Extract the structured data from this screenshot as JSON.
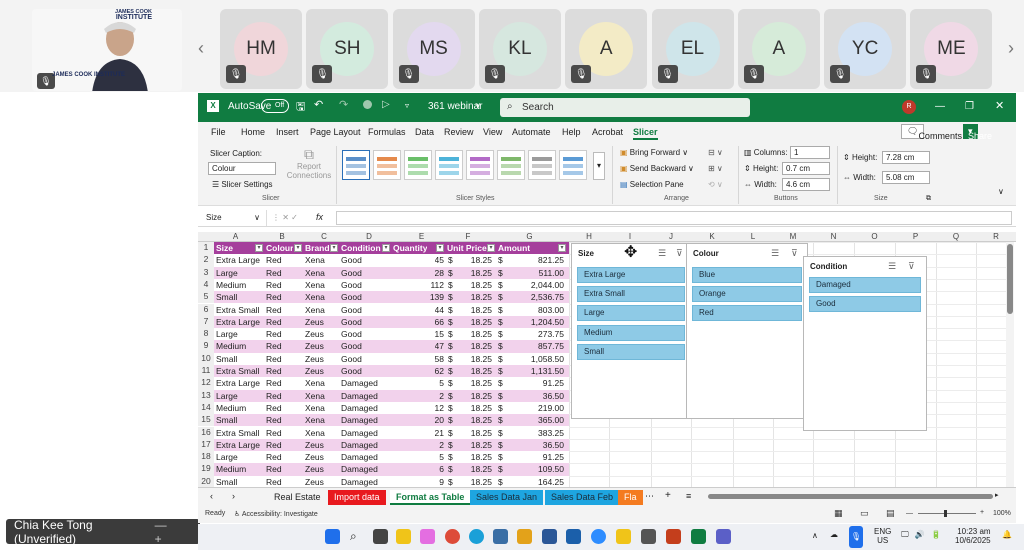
{
  "meeting": {
    "self_logo_line1": "JAMES COOK",
    "self_logo_line2": "INSTITUTE",
    "self_logo_overlay": "JAMES COOK INSTITUTE",
    "participants": [
      {
        "initials": "HM",
        "color": "#f0d6da"
      },
      {
        "initials": "SH",
        "color": "#d3ebde"
      },
      {
        "initials": "MS",
        "color": "#e3d9ef"
      },
      {
        "initials": "KL",
        "color": "#d6e7df"
      },
      {
        "initials": "A",
        "color": "#f3ebc6"
      },
      {
        "initials": "EL",
        "color": "#cfe5ea"
      },
      {
        "initials": "A",
        "color": "#d6ebd9"
      },
      {
        "initials": "YC",
        "color": "#d3e2f3"
      },
      {
        "initials": "ME",
        "color": "#f0d9e6"
      }
    ],
    "prev_arrow": "‹",
    "next_arrow": "›",
    "self_name": "Chia Kee Tong (Unverified)"
  },
  "excel": {
    "autosave_label": "AutoSave",
    "autosave_state": "Off",
    "file_name": "361 webinar",
    "search_placeholder": "Search",
    "user_initial": "R",
    "menu": [
      "File",
      "Home",
      "Insert",
      "Page Layout",
      "Formulas",
      "Data",
      "Review",
      "View",
      "Automate",
      "Help",
      "Acrobat",
      "Slicer"
    ],
    "comments_label": "Comments",
    "share_label": "Share",
    "ribbon": {
      "slicer_caption_label": "Slicer Caption:",
      "slicer_caption_value": "Colour",
      "slicer_settings": "Slicer Settings",
      "report_connections_1": "Report",
      "report_connections_2": "Connections",
      "group_slicer": "Slicer",
      "group_styles": "Slicer Styles",
      "bring_forward": "Bring Forward",
      "send_backward": "Send Backward",
      "selection_pane": "Selection Pane",
      "group_arrange": "Arrange",
      "columns_label": "Columns:",
      "columns_value": "1",
      "height_label": "Height:",
      "height_value": "0.7 cm",
      "width_label": "Width:",
      "width_value": "4.6 cm",
      "group_buttons": "Buttons",
      "size_height_label": "Height:",
      "size_height_value": "7.28 cm",
      "size_width_label": "Width:",
      "size_width_value": "5.08 cm",
      "group_size": "Size"
    },
    "name_box": "Size",
    "fx": "fx",
    "columns": [
      "A",
      "B",
      "C",
      "D",
      "E",
      "F",
      "G",
      "H",
      "I",
      "J",
      "K",
      "L",
      "M",
      "N",
      "O",
      "P",
      "Q",
      "R"
    ],
    "table_headers": [
      "Size",
      "Colour",
      "Brand",
      "Condition",
      "Quantity",
      "Unit Price",
      "Amount"
    ],
    "rows": [
      [
        "2",
        "Extra Large",
        "Red",
        "Xena",
        "Good",
        "45",
        "$",
        "18.25",
        "$",
        "821.25"
      ],
      [
        "3",
        "Large",
        "Red",
        "Xena",
        "Good",
        "28",
        "$",
        "18.25",
        "$",
        "511.00"
      ],
      [
        "4",
        "Medium",
        "Red",
        "Xena",
        "Good",
        "112",
        "$",
        "18.25",
        "$",
        "2,044.00"
      ],
      [
        "5",
        "Small",
        "Red",
        "Xena",
        "Good",
        "139",
        "$",
        "18.25",
        "$",
        "2,536.75"
      ],
      [
        "6",
        "Extra Small",
        "Red",
        "Xena",
        "Good",
        "44",
        "$",
        "18.25",
        "$",
        "803.00"
      ],
      [
        "7",
        "Extra Large",
        "Red",
        "Zeus",
        "Good",
        "66",
        "$",
        "18.25",
        "$",
        "1,204.50"
      ],
      [
        "8",
        "Large",
        "Red",
        "Zeus",
        "Good",
        "15",
        "$",
        "18.25",
        "$",
        "273.75"
      ],
      [
        "9",
        "Medium",
        "Red",
        "Zeus",
        "Good",
        "47",
        "$",
        "18.25",
        "$",
        "857.75"
      ],
      [
        "10",
        "Small",
        "Red",
        "Zeus",
        "Good",
        "58",
        "$",
        "18.25",
        "$",
        "1,058.50"
      ],
      [
        "11",
        "Extra Small",
        "Red",
        "Zeus",
        "Good",
        "62",
        "$",
        "18.25",
        "$",
        "1,131.50"
      ],
      [
        "12",
        "Extra Large",
        "Red",
        "Xena",
        "Damaged",
        "5",
        "$",
        "18.25",
        "$",
        "91.25"
      ],
      [
        "13",
        "Large",
        "Red",
        "Xena",
        "Damaged",
        "2",
        "$",
        "18.25",
        "$",
        "36.50"
      ],
      [
        "14",
        "Medium",
        "Red",
        "Xena",
        "Damaged",
        "12",
        "$",
        "18.25",
        "$",
        "219.00"
      ],
      [
        "15",
        "Small",
        "Red",
        "Xena",
        "Damaged",
        "20",
        "$",
        "18.25",
        "$",
        "365.00"
      ],
      [
        "16",
        "Extra Small",
        "Red",
        "Xena",
        "Damaged",
        "21",
        "$",
        "18.25",
        "$",
        "383.25"
      ],
      [
        "17",
        "Extra Large",
        "Red",
        "Zeus",
        "Damaged",
        "2",
        "$",
        "18.25",
        "$",
        "36.50"
      ],
      [
        "18",
        "Large",
        "Red",
        "Zeus",
        "Damaged",
        "5",
        "$",
        "18.25",
        "$",
        "91.25"
      ],
      [
        "19",
        "Medium",
        "Red",
        "Zeus",
        "Damaged",
        "6",
        "$",
        "18.25",
        "$",
        "109.50"
      ],
      [
        "20",
        "Small",
        "Red",
        "Zeus",
        "Damaged",
        "9",
        "$",
        "18.25",
        "$",
        "164.25"
      ]
    ],
    "slicers": {
      "size": {
        "title": "Size",
        "items": [
          "Extra Large",
          "Extra Small",
          "Large",
          "Medium",
          "Small"
        ]
      },
      "colour": {
        "title": "Colour",
        "items": [
          "Blue",
          "Orange",
          "Red"
        ]
      },
      "condition": {
        "title": "Condition",
        "items": [
          "Damaged",
          "Good"
        ]
      }
    },
    "sheet_tabs": [
      {
        "label": "Real Estate",
        "bg": "#f3f3f3",
        "fg": "#222"
      },
      {
        "label": "Import data",
        "bg": "#e8191e",
        "fg": "#fff"
      },
      {
        "label": "Format as Table",
        "bg": "#ffffff",
        "fg": "#107c41"
      },
      {
        "label": "Sales Data Jan",
        "bg": "#1ea5e0",
        "fg": "#1b2c3a"
      },
      {
        "label": "Sales Data Feb",
        "bg": "#1ea5e0",
        "fg": "#1b2c3a"
      },
      {
        "label": "Fla",
        "bg": "#f47b20",
        "fg": "#fff"
      }
    ],
    "status_ready": "Ready",
    "status_accessibility": "Accessibility: Investigate",
    "zoom": "100%"
  },
  "taskbar": {
    "lang1": "ENG",
    "lang2": "US",
    "time": "10:23 am",
    "date": "10/6/2025"
  },
  "colors": {
    "excel_green": "#107c41",
    "table_header": "#a53f9c",
    "band_odd": "#f2d2ec",
    "band_even": "#ffffff",
    "slicer_item": "#8ecae6"
  }
}
